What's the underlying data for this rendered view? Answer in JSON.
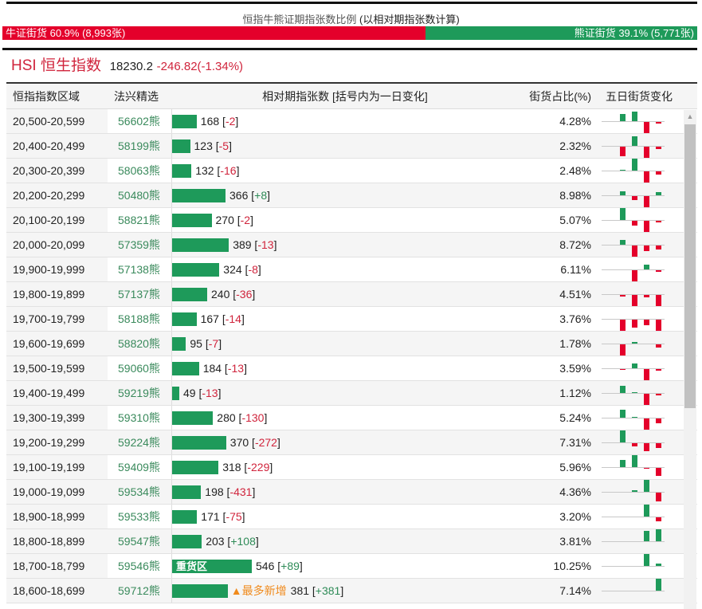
{
  "ratio": {
    "title": "恒指牛熊证期指张数比例",
    "title_note": "(以相对期指张数计算)",
    "bull_label": "牛证街货 60.9% (8,993张)",
    "bear_label": "熊证街货 39.1% (5,771张)",
    "bull_pct": 60.9,
    "colors": {
      "bull": "#e4002b",
      "bear": "#1e9a5a"
    }
  },
  "index": {
    "name": "HSI 恒生指数",
    "price": "18230.2",
    "change": "-246.82(-1.34%)"
  },
  "table": {
    "headers": [
      "恒指指数区域",
      "法兴精选",
      "相对期指张数 [括号内为一日变化]",
      "街货占比(%)",
      "五日街货变化"
    ],
    "max_count": 546,
    "rows": [
      {
        "range": "20,500-20,599",
        "code": "56602熊",
        "count": 168,
        "change": "-2",
        "pct": "4.28%",
        "spark": [
          0,
          9,
          12,
          -15,
          -2
        ]
      },
      {
        "range": "20,400-20,499",
        "code": "58199熊",
        "count": 123,
        "change": "-5",
        "pct": "2.32%",
        "spark": [
          0,
          -12,
          12,
          -15,
          -3
        ]
      },
      {
        "range": "20,300-20,399",
        "code": "58063熊",
        "count": 132,
        "change": "-16",
        "pct": "2.48%",
        "spark": [
          0,
          1,
          15,
          -14,
          -4
        ]
      },
      {
        "range": "20,200-20,299",
        "code": "50480熊",
        "count": 366,
        "change": "+8",
        "pct": "8.98%",
        "spark": [
          0,
          5,
          -5,
          -15,
          4
        ]
      },
      {
        "range": "20,100-20,199",
        "code": "58821熊",
        "count": 270,
        "change": "-2",
        "pct": "5.07%",
        "spark": [
          0,
          15,
          -6,
          -15,
          -2
        ]
      },
      {
        "range": "20,000-20,099",
        "code": "57359熊",
        "count": 389,
        "change": "-13",
        "pct": "8.72%",
        "spark": [
          0,
          6,
          -15,
          -7,
          -5
        ]
      },
      {
        "range": "19,900-19,999",
        "code": "57138熊",
        "count": 324,
        "change": "-8",
        "pct": "6.11%",
        "spark": [
          0,
          0,
          -15,
          6,
          -2
        ]
      },
      {
        "range": "19,800-19,899",
        "code": "57137熊",
        "count": 240,
        "change": "-36",
        "pct": "4.51%",
        "spark": [
          0,
          -2,
          -15,
          -3,
          -14
        ]
      },
      {
        "range": "19,700-19,799",
        "code": "58188熊",
        "count": 167,
        "change": "-14",
        "pct": "3.76%",
        "spark": [
          0,
          -15,
          -10,
          -7,
          -15
        ]
      },
      {
        "range": "19,600-19,699",
        "code": "58820熊",
        "count": 95,
        "change": "-7",
        "pct": "1.78%",
        "spark": [
          0,
          -15,
          2,
          0,
          -4
        ]
      },
      {
        "range": "19,500-19,599",
        "code": "59060熊",
        "count": 184,
        "change": "-13",
        "pct": "3.59%",
        "spark": [
          0,
          -1,
          6,
          -15,
          -2
        ]
      },
      {
        "range": "19,400-19,499",
        "code": "59219熊",
        "count": 49,
        "change": "-13",
        "pct": "1.12%",
        "spark": [
          0,
          9,
          1,
          -15,
          -2
        ]
      },
      {
        "range": "19,300-19,399",
        "code": "59310熊",
        "count": 280,
        "change": "-130",
        "pct": "5.24%",
        "spark": [
          0,
          10,
          1,
          -15,
          -6
        ]
      },
      {
        "range": "19,200-19,299",
        "code": "59224熊",
        "count": 370,
        "change": "-272",
        "pct": "7.31%",
        "spark": [
          0,
          15,
          -4,
          -10,
          -6
        ]
      },
      {
        "range": "19,100-19,199",
        "code": "59409熊",
        "count": 318,
        "change": "-229",
        "pct": "5.96%",
        "spark": [
          0,
          9,
          15,
          -1,
          -10
        ]
      },
      {
        "range": "19,000-19,099",
        "code": "59534熊",
        "count": 198,
        "change": "-431",
        "pct": "4.36%",
        "spark": [
          0,
          0,
          2,
          15,
          -11
        ]
      },
      {
        "range": "18,900-18,999",
        "code": "59533熊",
        "count": 171,
        "change": "-75",
        "pct": "3.20%",
        "spark": [
          0,
          0,
          0,
          15,
          -5
        ]
      },
      {
        "range": "18,800-18,899",
        "code": "59547熊",
        "count": 203,
        "change": "+108",
        "pct": "3.81%",
        "spark": [
          0,
          0,
          0,
          13,
          15
        ]
      },
      {
        "range": "18,700-18,799",
        "code": "59546熊",
        "count": 546,
        "change": "+89",
        "pct": "10.25%",
        "bar_label": "重货区",
        "spark": [
          0,
          0,
          0,
          15,
          3
        ]
      },
      {
        "range": "18,600-18,699",
        "code": "59712熊",
        "count": 381,
        "change": "+381",
        "pct": "7.14%",
        "tag": "▲最多新增",
        "spark": [
          0,
          0,
          0,
          0,
          15
        ]
      }
    ]
  }
}
